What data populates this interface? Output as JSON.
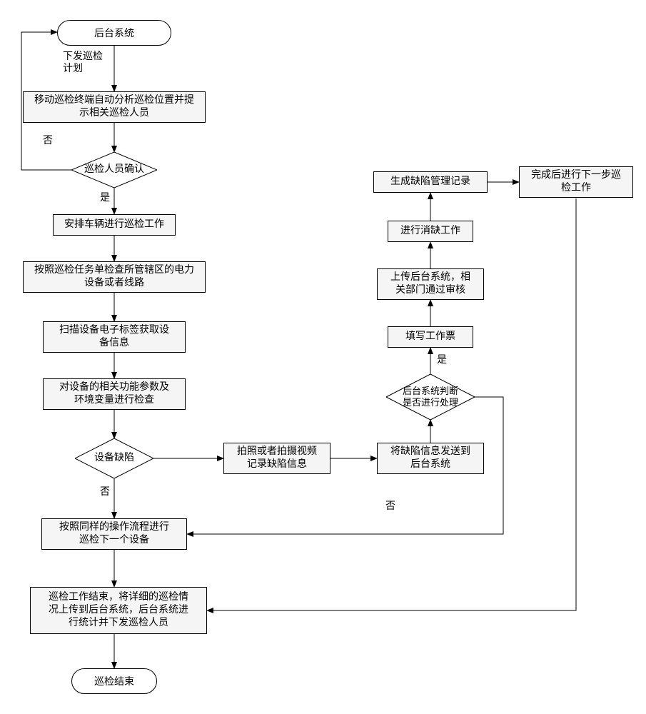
{
  "nodes": {
    "start": {
      "label": "后台系统"
    },
    "analyze": {
      "label": "移动巡检终端自动分析巡检位置并提\n示相关巡检人员"
    },
    "confirm": {
      "label": "巡检人员确认"
    },
    "arrange": {
      "label": "安排车辆进行巡检工作"
    },
    "taskcheck": {
      "label": "按照巡检任务单检查所管辖区的电力\n设备或者线路"
    },
    "scan": {
      "label": "扫描设备电子标签获取设\n备信息"
    },
    "params": {
      "label": "对设备的相关功能参数及\n环境变量进行检查"
    },
    "defect": {
      "label": "设备缺陷"
    },
    "photo": {
      "label": "拍照或者拍摄视频\n记录缺陷信息"
    },
    "send": {
      "label": "将缺陷信息发送到\n后台系统"
    },
    "judge": {
      "label": "后台系统判断\n是否进行处理"
    },
    "ticket": {
      "label": "填写工作票"
    },
    "upload": {
      "label": "上传后台系统，相\n关部门通过审核"
    },
    "elim": {
      "label": "进行消缺工作"
    },
    "record": {
      "label": "生成缺陷管理记录"
    },
    "nextwork": {
      "label": "完成后进行下一步巡\n检工作"
    },
    "nextdev": {
      "label": "按照同样的操作流程进行\n巡检下一个设备"
    },
    "finish": {
      "label": "巡检工作结束，将详细的巡检情\n况上传到后台系统，后台系统进\n行统计并下发巡检人员"
    },
    "end": {
      "label": "巡检结束"
    }
  },
  "edges": {
    "issue_plan": "下发巡检\n计划",
    "yes": "是",
    "no": "否"
  }
}
